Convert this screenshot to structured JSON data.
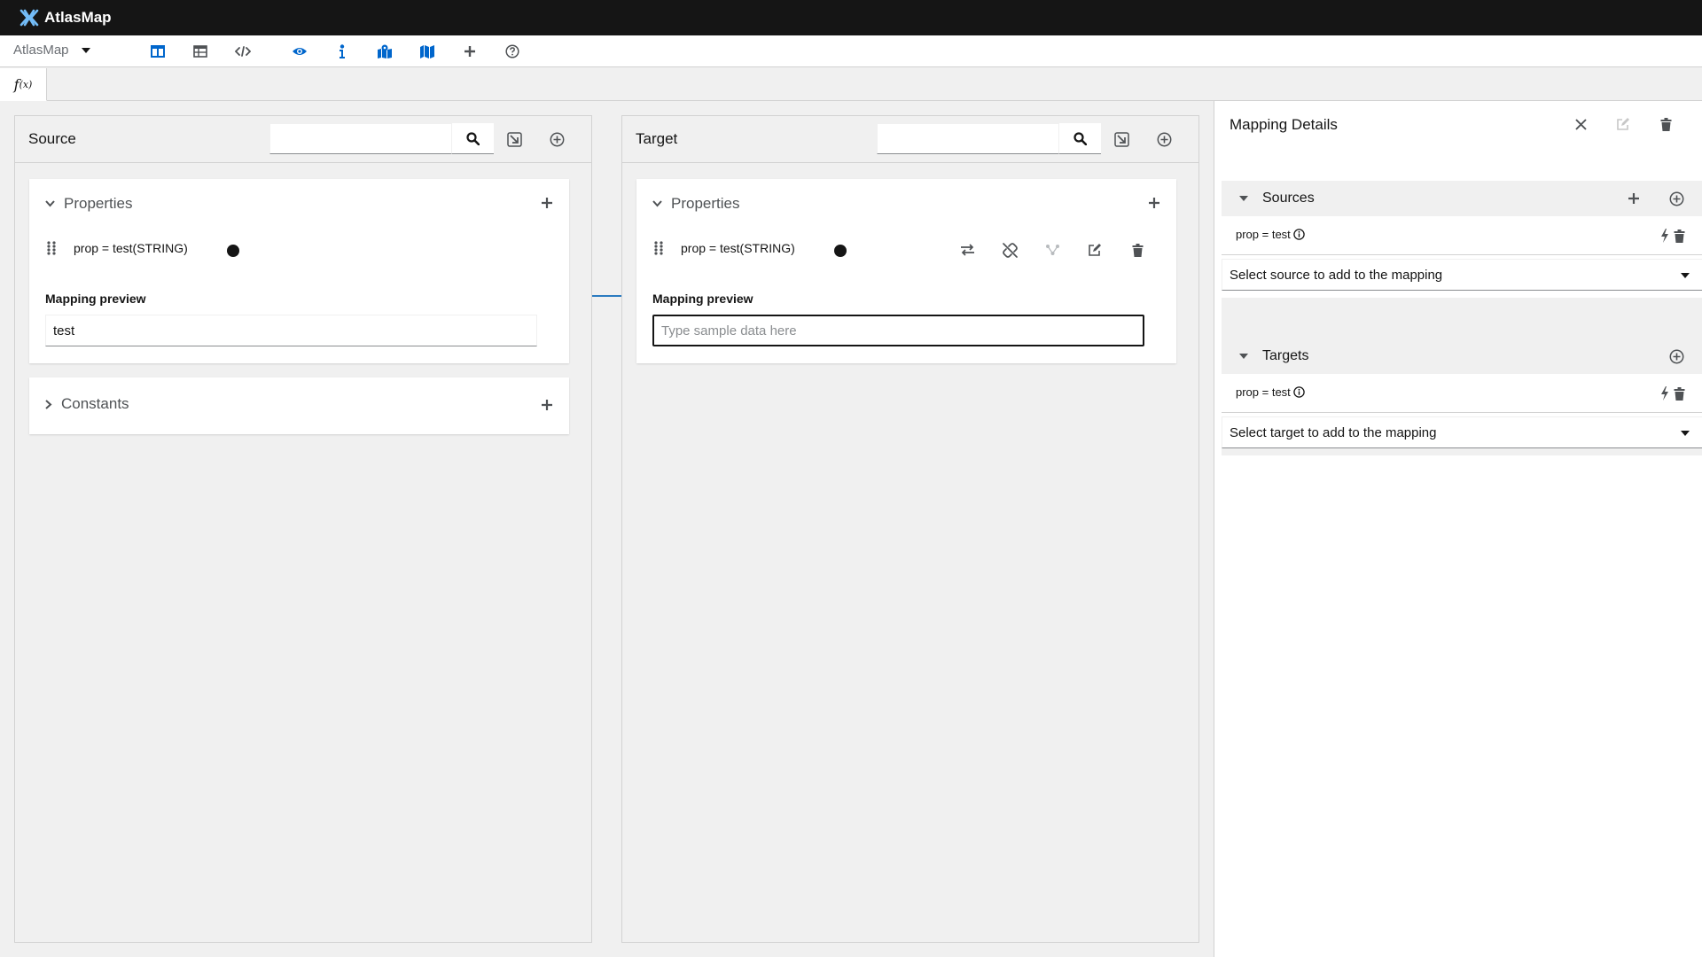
{
  "masthead": {
    "brand": "AtlasMap"
  },
  "toolbar": {
    "app_select": "AtlasMap",
    "buttons": [
      "columns-icon",
      "table-icon",
      "code-icon",
      "eye-icon",
      "info-icon",
      "map-marked-icon",
      "map-icon",
      "plus-icon",
      "help-icon"
    ]
  },
  "fx_tab": {
    "main": "f",
    "sub": "(x)"
  },
  "source": {
    "title": "Source",
    "search_placeholder": "",
    "properties": {
      "label": "Properties",
      "field": "prop = test(STRING)",
      "preview_label": "Mapping preview",
      "preview_value": "test"
    },
    "constants": {
      "label": "Constants"
    }
  },
  "target": {
    "title": "Target",
    "search_placeholder": "",
    "properties": {
      "label": "Properties",
      "field": "prop = test(STRING)",
      "preview_label": "Mapping preview",
      "preview_placeholder": "Type sample data here"
    }
  },
  "details": {
    "title": "Mapping Details",
    "sources": {
      "label": "Sources",
      "item": "prop = test",
      "select": "Select source to add to the mapping"
    },
    "targets": {
      "label": "Targets",
      "item": "prop = test",
      "select": "Select target to add to the mapping"
    }
  },
  "colors": {
    "accent": "#0066cc",
    "masthead": "#151515",
    "connector": "#2b7bc0",
    "background": "#f0f0f0"
  }
}
